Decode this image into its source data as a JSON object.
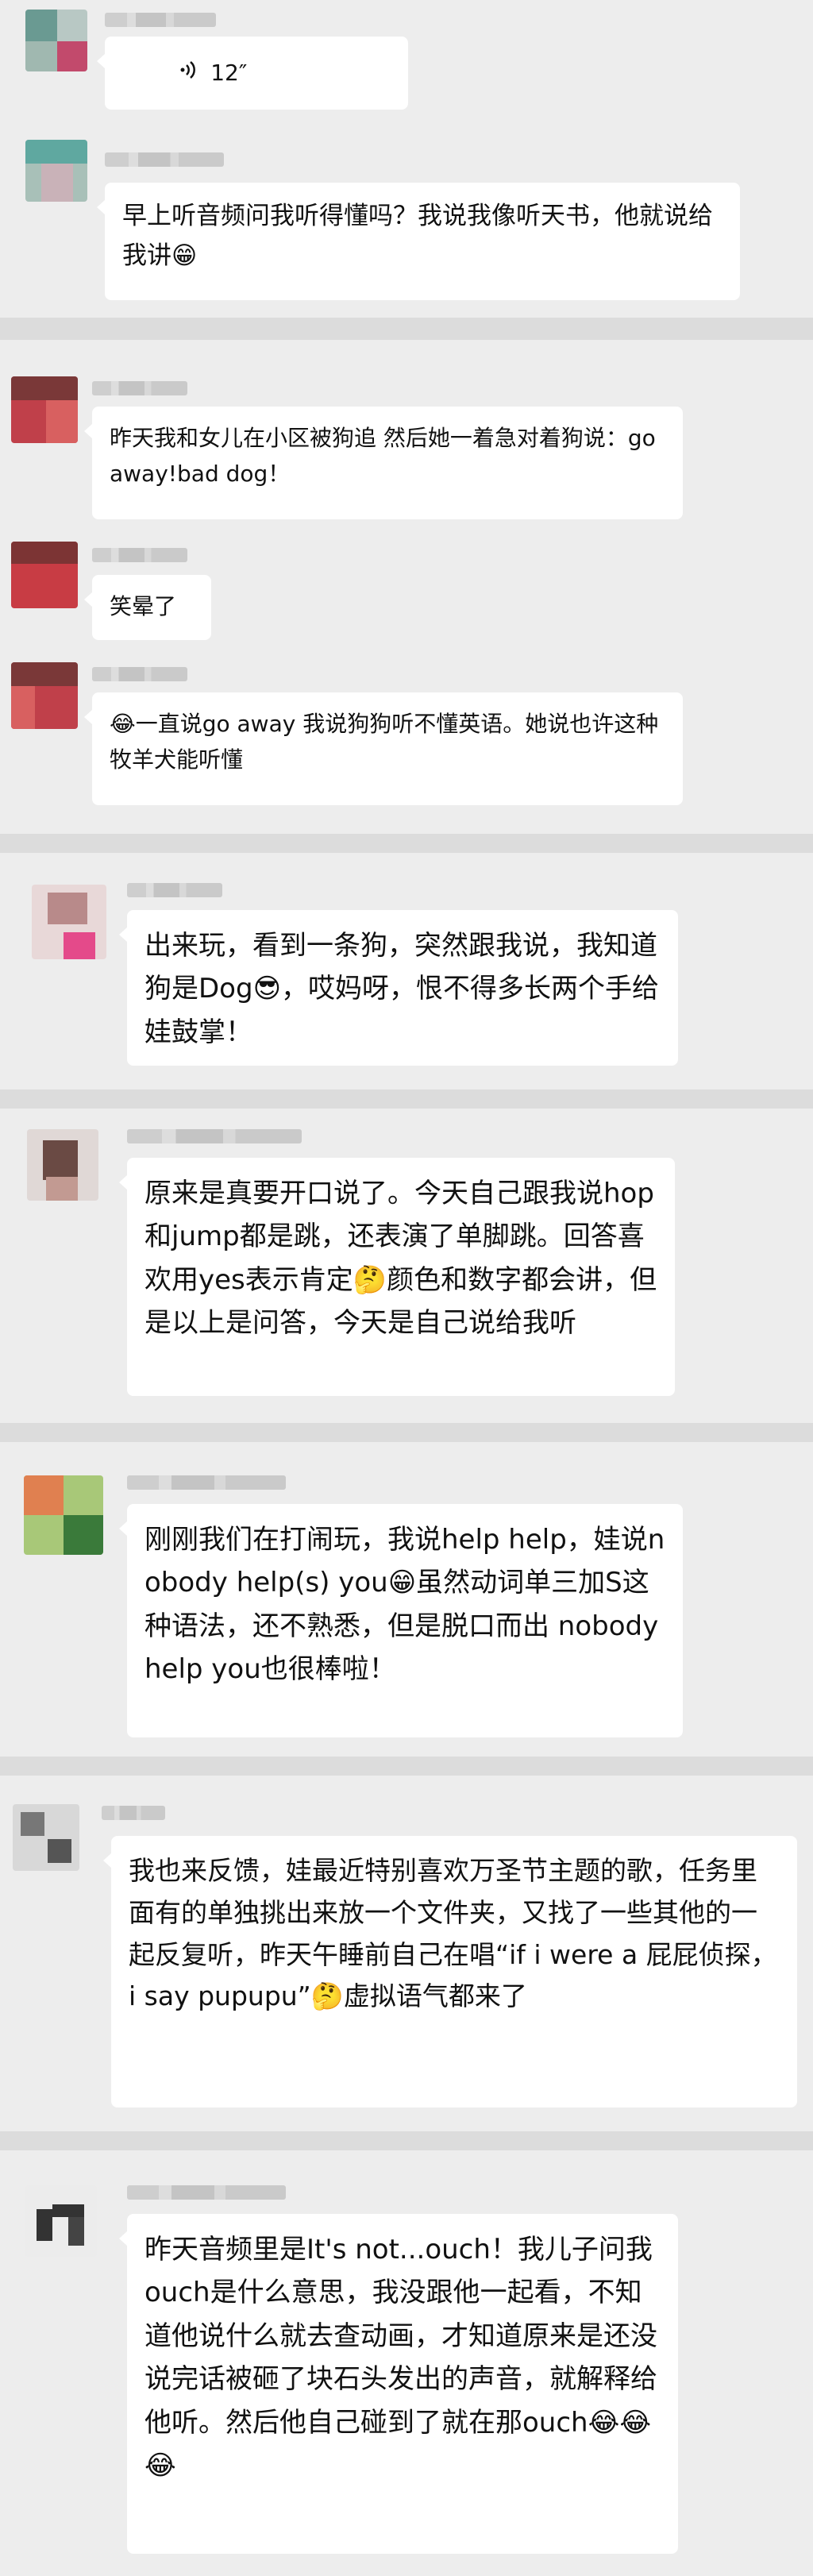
{
  "threads": [
    {
      "messages": [
        {
          "type": "voice",
          "duration": "12″",
          "icon": "voice-wave-icon"
        },
        {
          "type": "text",
          "text": "早上听音频问我听得懂吗？我说我像听天书，他就说给我讲😁"
        }
      ]
    },
    {
      "messages": [
        {
          "type": "text",
          "text": "昨天我和女儿在小区被狗追 然后她一着急对着狗说：go away!bad dog！"
        },
        {
          "type": "text",
          "text": "笑晕了"
        },
        {
          "type": "text",
          "text": "😂一直说go away 我说狗狗听不懂英语。她说也许这种牧羊犬能听懂"
        }
      ]
    },
    {
      "messages": [
        {
          "type": "text",
          "text": "出来玩，看到一条狗，突然跟我说，我知道狗是Dog😎，哎妈呀，恨不得多长两个手给娃鼓掌！"
        }
      ]
    },
    {
      "messages": [
        {
          "type": "text",
          "text": "原来是真要开口说了。今天自己跟我说hop和jump都是跳，还表演了单脚跳。回答喜欢用yes表示肯定🤔颜色和数字都会讲，但是以上是问答，今天是自己说给我听"
        }
      ]
    },
    {
      "messages": [
        {
          "type": "text",
          "text": "刚刚我们在打闹玩，我说help help，娃说nobody help(s) you😁虽然动词单三加S这种语法，还不熟悉，但是脱口而出 nobody help you也很棒啦！"
        }
      ]
    },
    {
      "messages": [
        {
          "type": "text",
          "text": "我也来反馈，娃最近特别喜欢万圣节主题的歌，任务里面有的单独挑出来放一个文件夹，又找了一些其他的一起反复听，昨天午睡前自己在唱“if i were a 屁屁侦探，i say pupupu”🤔虚拟语气都来了"
        }
      ]
    },
    {
      "messages": [
        {
          "type": "text",
          "text": "昨天音频里是It's not...ouch！我儿子问我ouch是什么意思，我没跟他一起看，不知道他说什么就去查动画，才知道原来是还没说完话被砸了块石头发出的声音，就解释给他听。然后他自己碰到了就在那ouch😂😂😂"
        }
      ]
    }
  ]
}
